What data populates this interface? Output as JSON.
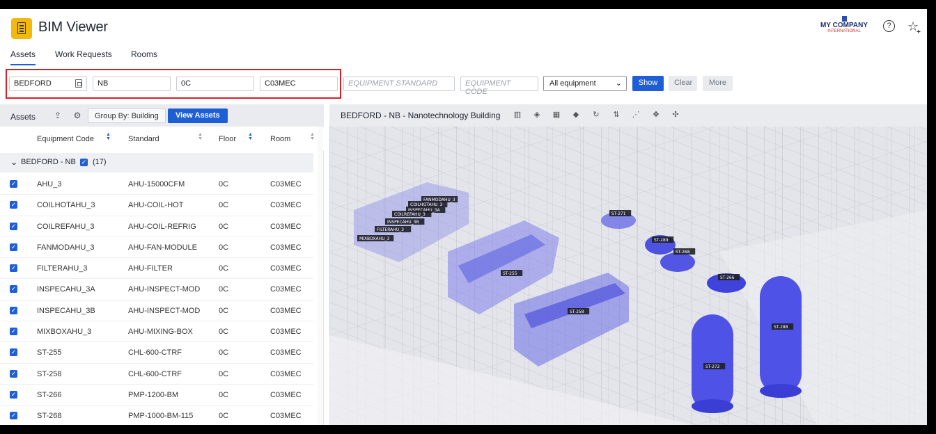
{
  "app": {
    "title": "BIM Viewer"
  },
  "brand": {
    "name": "MY COMPANY",
    "sub": "INTERNATIONAL"
  },
  "header_icons": {
    "help": "help-circle-icon",
    "favorite": "star-add-icon"
  },
  "tabs": [
    {
      "label": "Assets",
      "active": true
    },
    {
      "label": "Work Requests",
      "active": false
    },
    {
      "label": "Rooms",
      "active": false
    }
  ],
  "filters": {
    "site": {
      "value": "BEDFORD"
    },
    "building": {
      "value": "NB"
    },
    "floor": {
      "value": "0C"
    },
    "room": {
      "value": "C03MEC"
    },
    "equipment_standard": {
      "placeholder": "EQUIPMENT STANDARD"
    },
    "equipment_code": {
      "placeholder": "EQUIPMENT CODE"
    },
    "equipment_select": {
      "selected": "All equipment"
    },
    "show_label": "Show",
    "clear_label": "Clear",
    "more_label": "More"
  },
  "assets_panel": {
    "title": "Assets",
    "group_by_label": "Group By: Building",
    "view_assets_label": "View Assets",
    "columns": [
      "Equipment Code",
      "Standard",
      "Floor",
      "Room"
    ],
    "group": {
      "name": "BEDFORD - NB",
      "count": "(17)"
    },
    "rows": [
      {
        "code": "AHU_3",
        "standard": "AHU-15000CFM",
        "floor": "0C",
        "room": "C03MEC"
      },
      {
        "code": "COILHOTAHU_3",
        "standard": "AHU-COIL-HOT",
        "floor": "0C",
        "room": "C03MEC"
      },
      {
        "code": "COILREFAHU_3",
        "standard": "AHU-COIL-REFRIG",
        "floor": "0C",
        "room": "C03MEC"
      },
      {
        "code": "FANMODAHU_3",
        "standard": "AHU-FAN-MODULE",
        "floor": "0C",
        "room": "C03MEC"
      },
      {
        "code": "FILTERAHU_3",
        "standard": "AHU-FILTER",
        "floor": "0C",
        "room": "C03MEC"
      },
      {
        "code": "INSPECAHU_3A",
        "standard": "AHU-INSPECT-MOD",
        "floor": "0C",
        "room": "C03MEC"
      },
      {
        "code": "INSPECAHU_3B",
        "standard": "AHU-INSPECT-MOD",
        "floor": "0C",
        "room": "C03MEC"
      },
      {
        "code": "MIXBOXAHU_3",
        "standard": "AHU-MIXING-BOX",
        "floor": "0C",
        "room": "C03MEC"
      },
      {
        "code": "ST-255",
        "standard": "CHL-600-CTRF",
        "floor": "0C",
        "room": "C03MEC"
      },
      {
        "code": "ST-258",
        "standard": "CHL-600-CTRF",
        "floor": "0C",
        "room": "C03MEC"
      },
      {
        "code": "ST-266",
        "standard": "PMP-1200-BM",
        "floor": "0C",
        "room": "C03MEC"
      },
      {
        "code": "ST-268",
        "standard": "PMP-1000-BM-115",
        "floor": "0C",
        "room": "C03MEC"
      }
    ]
  },
  "viewer": {
    "title": "BEDFORD - NB - Nanotechnology Building",
    "tools": [
      "building-icon",
      "layers-icon",
      "grid-icon",
      "tag-icon",
      "refresh-icon",
      "filter-icon",
      "share-icon",
      "explode-icon",
      "move-icon"
    ],
    "labels": [
      "FANMODAHU_3",
      "COILHOTAHU_3",
      "INSPECAHU_3A",
      "COILREFAHU_3",
      "INSPECAHU_3B",
      "FILTERAHU_3",
      "MIXBOXAHU_3",
      "ST-271",
      "ST-289",
      "ST-268",
      "ST-255",
      "ST-266",
      "ST-258",
      "ST-288",
      "ST-272"
    ]
  },
  "colors": {
    "accent": "#1f5fd6",
    "highlight": "#d81f26",
    "logo": "#f2b90d",
    "equipment": "#4a4de8"
  }
}
